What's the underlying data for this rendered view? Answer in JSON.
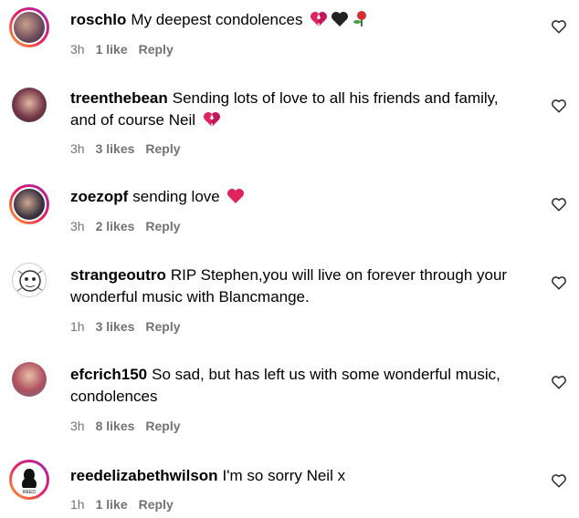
{
  "comments": [
    {
      "username": "roschlo",
      "text": "My deepest condolences",
      "time": "3h",
      "likes": "1 like",
      "reply": "Reply",
      "emojis": [
        "broken-heart",
        "black-heart",
        "rose"
      ]
    },
    {
      "username": "treenthebean",
      "text": "Sending lots of love to all his friends and family, and of course Neil",
      "time": "3h",
      "likes": "3 likes",
      "reply": "Reply",
      "emojis": [
        "broken-heart"
      ]
    },
    {
      "username": "zoezopf",
      "text": "sending love",
      "time": "3h",
      "likes": "2 likes",
      "reply": "Reply",
      "emojis": [
        "red-heart"
      ]
    },
    {
      "username": "strangeoutro",
      "text": "RIP Stephen,you will live on forever through your wonderful music with Blancmange.",
      "time": "1h",
      "likes": "3 likes",
      "reply": "Reply",
      "emojis": []
    },
    {
      "username": "efcrich150",
      "text": "So sad, but has left us with some wonderful music, condolences",
      "time": "3h",
      "likes": "8 likes",
      "reply": "Reply",
      "emojis": []
    },
    {
      "username": "reedelizabethwilson",
      "text": "I'm so sorry Neil x",
      "time": "1h",
      "likes": "1 like",
      "reply": "Reply",
      "emojis": []
    }
  ],
  "avatar_logo_text": "REED",
  "colors": {
    "meta": "#737373",
    "ring_start": "#f9a825",
    "ring_mid": "#e91e63",
    "ring_end": "#9c27b0",
    "heart_red": "#e0245e"
  }
}
